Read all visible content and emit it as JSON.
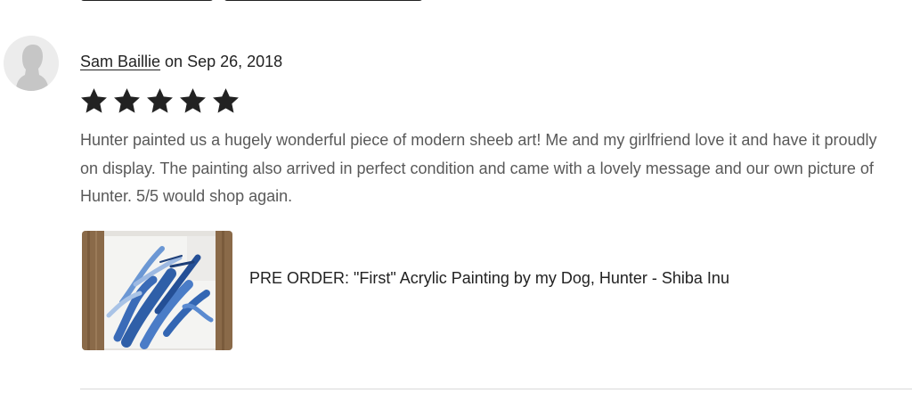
{
  "review": {
    "reviewer_name": "Sam Baillie",
    "date_prefix": " on ",
    "date": "Sep 26, 2018",
    "rating": 5,
    "rating_max": 5,
    "text": "Hunter painted us a hugely wonderful piece of modern sheeb art! Me and my girlfriend love it and have it proudly on display. The painting also arrived in perfect condition and came with a lovely message and our own picture of Hunter. 5/5 would shop again."
  },
  "product": {
    "title": "PRE ORDER: \"First\" Acrylic Painting by my Dog, Hunter - Shiba Inu",
    "thumbnail_icon": "painting-thumbnail"
  },
  "avatar": {
    "icon": "default-user-silhouette-icon"
  },
  "colors": {
    "star": "#222222",
    "body_text": "#595959",
    "heading_text": "#222222",
    "divider": "#d9d9d9",
    "paint_blue": "#2f5fa8"
  }
}
